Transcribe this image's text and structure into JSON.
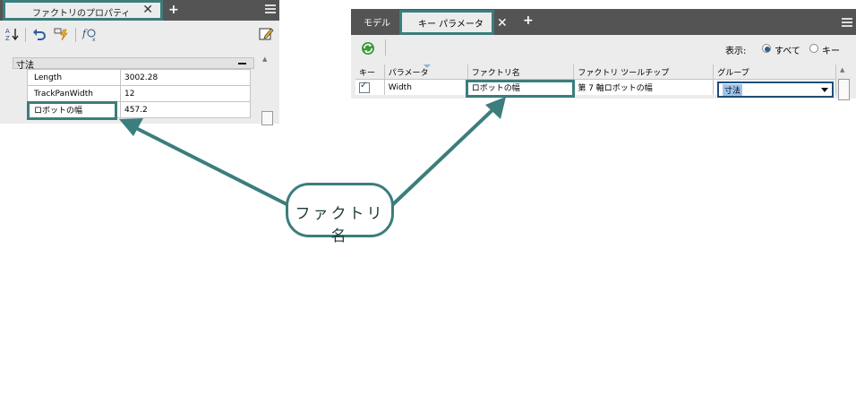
{
  "left_panel": {
    "tab_title": "ファクトリのプロパティ",
    "tab_close": "✕",
    "add_tab": "+",
    "section_title": "寸法",
    "properties": [
      {
        "name": "Length",
        "value": "3002.28"
      },
      {
        "name": "TrackPanWidth",
        "value": "12"
      },
      {
        "name": "ロボットの幅",
        "value": "457.2"
      }
    ]
  },
  "right_panel": {
    "tabs": [
      {
        "label": "モデル"
      },
      {
        "label": "キー パラメータ"
      }
    ],
    "tab_close": "✕",
    "add_tab": "+",
    "display_label": "表示:",
    "radio_all": "すべて",
    "radio_key": "キー",
    "columns": [
      "キー",
      "パラメータ",
      "ファクトリ名",
      "ファクトリ ツールチップ",
      "グループ"
    ],
    "row": {
      "key_checked": true,
      "parameter": "Width",
      "factory_name": "ロボットの幅",
      "tooltip": "第 7 軸ロボットの幅",
      "group": "寸法"
    }
  },
  "callout": {
    "label": "ファクトリ名"
  },
  "colors": {
    "accent": "#3c7d7d",
    "tabbar": "#545454",
    "panel": "#ececec"
  }
}
